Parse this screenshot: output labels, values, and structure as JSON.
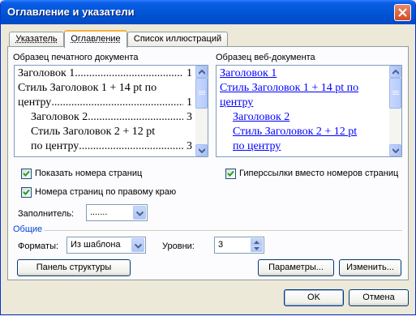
{
  "window": {
    "title": "Оглавление и указатели"
  },
  "tabs": [
    {
      "label": "Указатель",
      "active": false
    },
    {
      "label": "Оглавление",
      "active": true
    },
    {
      "label": "Список иллюстраций",
      "active": false
    }
  ],
  "print_preview": {
    "label": "Образец печатного документа",
    "lines": [
      {
        "text": "Заголовок 1",
        "page": "1",
        "indent": 0
      },
      {
        "text": "Стиль Заголовок 1 + 14 pt по",
        "page": "",
        "indent": 0
      },
      {
        "text": "центру",
        "page": "1",
        "indent": 0
      },
      {
        "text": "Заголовок 2",
        "page": "3",
        "indent": 1
      },
      {
        "text": "Стиль Заголовок 2 + 12 pt",
        "page": "",
        "indent": 1
      },
      {
        "text": "по центру",
        "page": "3",
        "indent": 1
      }
    ]
  },
  "web_preview": {
    "label": "Образец веб-документа",
    "lines": [
      {
        "text": "Заголовок 1",
        "indent": 0
      },
      {
        "text": "Стиль Заголовок 1 + 14 pt по",
        "indent": 0
      },
      {
        "text": "центру",
        "indent": 0
      },
      {
        "text": "Заголовок 2",
        "indent": 1
      },
      {
        "text": "Стиль Заголовок 2 + 12 pt",
        "indent": 1
      },
      {
        "text": "по центру",
        "indent": 1
      }
    ]
  },
  "options": {
    "show_page_numbers": {
      "label": "Показать номера страниц",
      "checked": true
    },
    "right_align": {
      "label": "Номера страниц по правому краю",
      "checked": true
    },
    "hyperlinks": {
      "label": "Гиперссылки вместо номеров страниц",
      "checked": true
    },
    "tab_leader": {
      "label": "Заполнитель:",
      "value": "......."
    }
  },
  "general": {
    "label": "Общие",
    "formats_label": "Форматы:",
    "formats_value": "Из шаблона",
    "levels_label": "Уровни:",
    "levels_value": "3"
  },
  "buttons": {
    "outline_toolbar": "Панель структуры",
    "options": "Параметры...",
    "modify": "Изменить...",
    "ok": "OK",
    "cancel": "Отмена"
  },
  "colors": {
    "titlebar": "#0458d8",
    "accent": "#f7b13a",
    "link": "#0000ff"
  }
}
